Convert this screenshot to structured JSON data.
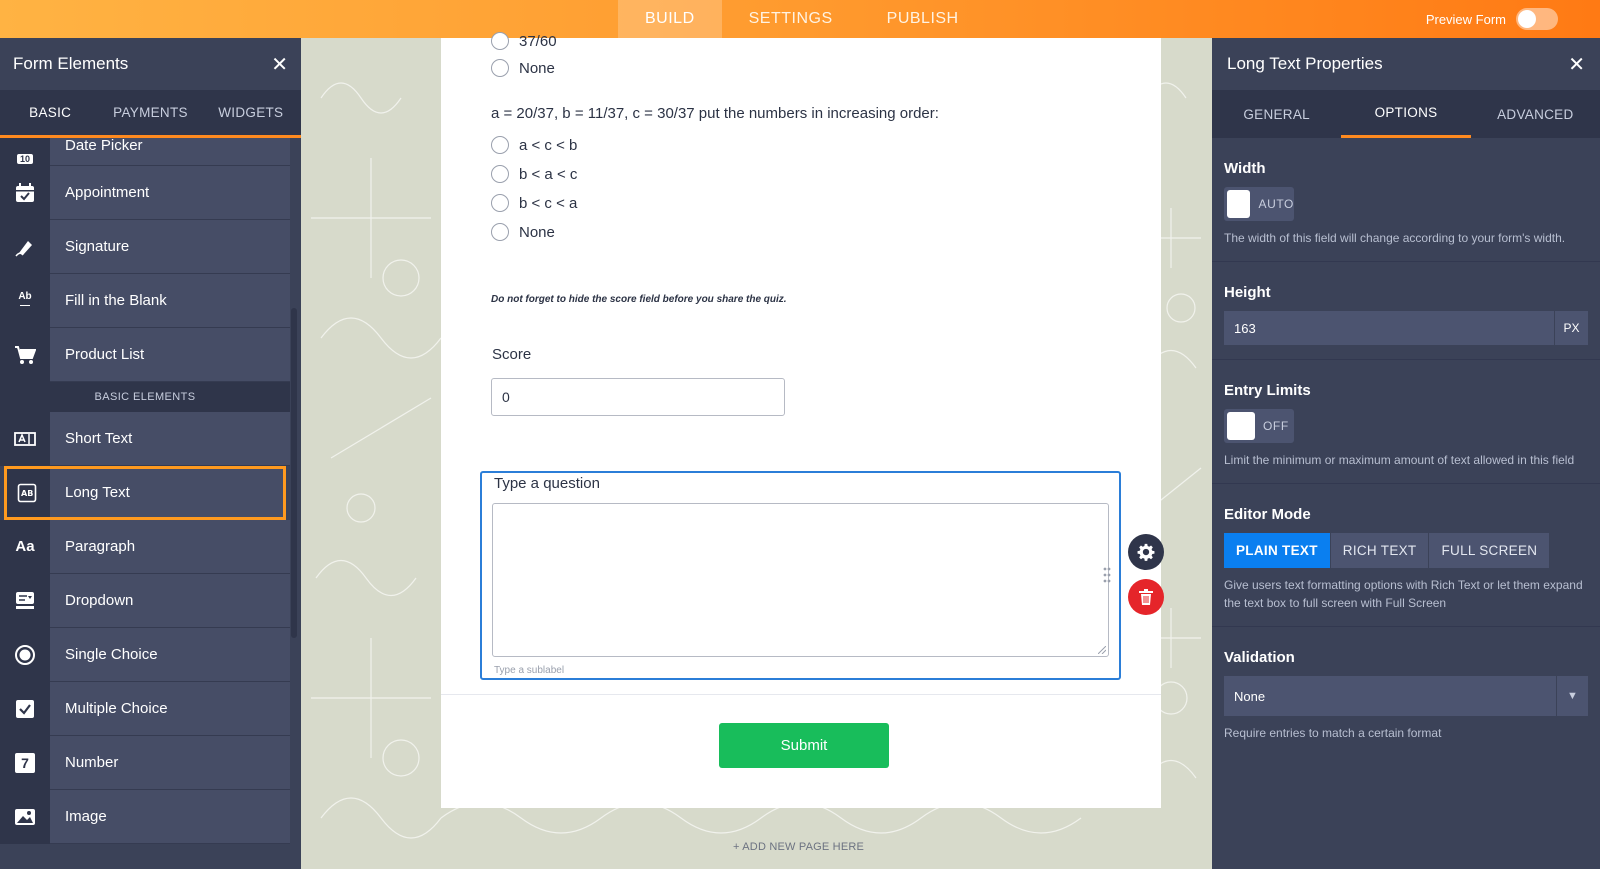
{
  "topbar": {
    "tabs": [
      "BUILD",
      "SETTINGS",
      "PUBLISH"
    ],
    "preview_label": "Preview Form"
  },
  "left_panel": {
    "title": "Form Elements",
    "tabs": [
      "BASIC",
      "PAYMENTS",
      "WIDGETS"
    ],
    "items_top": [
      {
        "icon": "calendar-icon",
        "label": "Date Picker"
      },
      {
        "icon": "appointment-icon",
        "label": "Appointment"
      },
      {
        "icon": "signature-icon",
        "label": "Signature"
      },
      {
        "icon": "fill-blank-icon",
        "label": "Fill in the Blank"
      },
      {
        "icon": "cart-icon",
        "label": "Product List"
      }
    ],
    "section_label": "BASIC ELEMENTS",
    "items_basic": [
      {
        "icon": "short-text-icon",
        "label": "Short Text"
      },
      {
        "icon": "long-text-icon",
        "label": "Long Text"
      },
      {
        "icon": "paragraph-icon",
        "label": "Paragraph"
      },
      {
        "icon": "dropdown-icon",
        "label": "Dropdown"
      },
      {
        "icon": "single-choice-icon",
        "label": "Single Choice"
      },
      {
        "icon": "multiple-choice-icon",
        "label": "Multiple Choice"
      },
      {
        "icon": "number-icon",
        "label": "Number"
      },
      {
        "icon": "image-icon",
        "label": "Image"
      }
    ],
    "icon_glyphs": {
      "date_picker": "10",
      "fill_blank": "Ab",
      "paragraph": "Aa",
      "number": "7"
    }
  },
  "form": {
    "q_prev_option_partial": "37/60",
    "q_prev_option_none": "None",
    "question": "a = 20/37, b = 11/37,  c = 30/37 put the numbers in increasing order:",
    "options": [
      "a < c < b",
      "b < a < c",
      "b < c < a",
      "None"
    ],
    "note": "Do not forget to hide the score field before you share the quiz.",
    "score_label": "Score",
    "score_value": "0",
    "longtext_label": "Type a question",
    "longtext_sublabel": "Type a sublabel",
    "submit_label": "Submit",
    "add_page": "+ ADD NEW PAGE HERE"
  },
  "right_panel": {
    "title": "Long Text Properties",
    "tabs": [
      "GENERAL",
      "OPTIONS",
      "ADVANCED"
    ],
    "width": {
      "title": "Width",
      "toggle": "AUTO",
      "desc": "The width of this field will change according to your form's width."
    },
    "height": {
      "title": "Height",
      "value": "163",
      "unit": "PX"
    },
    "entry_limits": {
      "title": "Entry Limits",
      "toggle": "OFF",
      "desc": "Limit the minimum or maximum amount of text allowed in this field"
    },
    "editor_mode": {
      "title": "Editor Mode",
      "options": [
        "PLAIN TEXT",
        "RICH TEXT",
        "FULL SCREEN"
      ],
      "desc": "Give users text formatting options with Rich Text or let them expand the text box to full screen with Full Screen"
    },
    "validation": {
      "title": "Validation",
      "value": "None",
      "desc": "Require entries to match a certain format"
    }
  },
  "colors": {
    "accent": "#ff8a1f",
    "panel": "#3b4258",
    "primary": "#0a7ff0",
    "submit": "#18bd5b",
    "delete": "#e5252a"
  }
}
